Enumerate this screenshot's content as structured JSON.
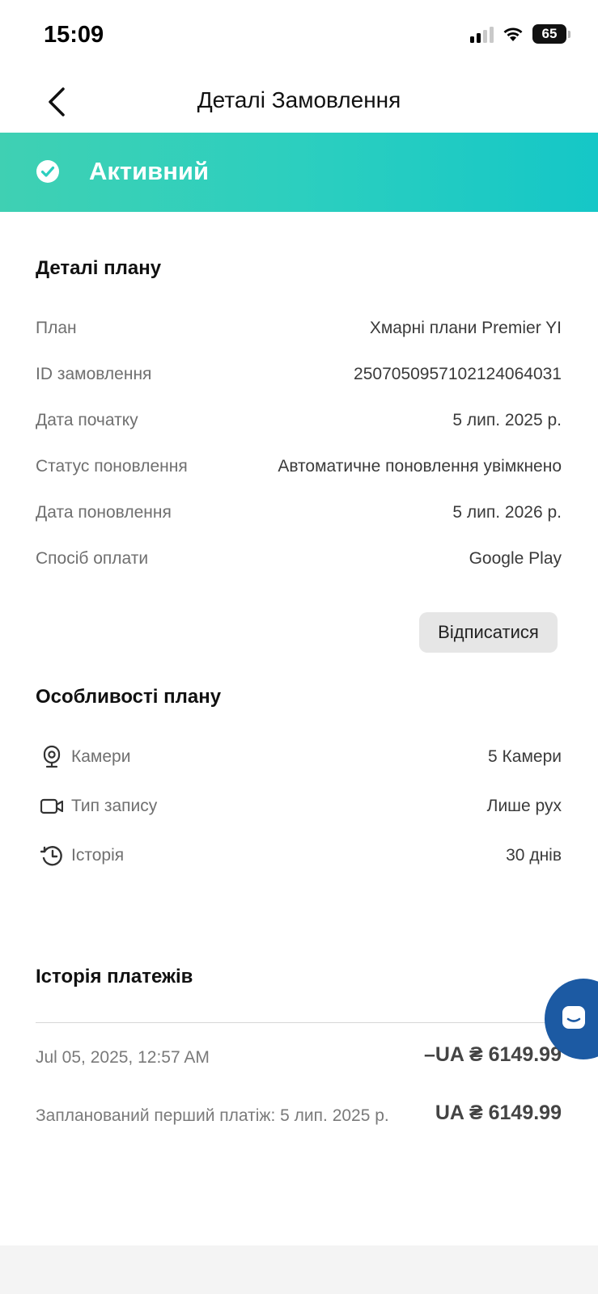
{
  "status_bar": {
    "time": "15:09",
    "battery": "65"
  },
  "nav": {
    "title": "Деталі Замовлення"
  },
  "banner": {
    "status": "Активний",
    "color": "#2ccfbf"
  },
  "plan_details": {
    "title": "Деталі плану",
    "rows": [
      {
        "label": "План",
        "value": "Хмарні плани Premier YI"
      },
      {
        "label": "ID замовлення",
        "value": "2507050957102124064031"
      },
      {
        "label": "Дата початку",
        "value": "5 лип. 2025 р."
      },
      {
        "label": "Статус поновлення",
        "value": "Автоматичне поновлення увімкнено"
      },
      {
        "label": "Дата поновлення",
        "value": "5 лип. 2026 р."
      },
      {
        "label": "Спосіб оплати",
        "value": "Google Play"
      }
    ],
    "unsubscribe_label": "Відписатися"
  },
  "features": {
    "title": "Особливості плану",
    "items": [
      {
        "icon": "camera-icon",
        "label": "Камери",
        "value": "5 Камери"
      },
      {
        "icon": "video-icon",
        "label": "Тип запису",
        "value": "Лише рух"
      },
      {
        "icon": "history-icon",
        "label": "Історія",
        "value": "30 днів"
      }
    ]
  },
  "payments": {
    "title": "Історія платежів",
    "items": [
      {
        "date": "Jul 05, 2025, 12:57 AM",
        "amount": "–UA ₴ 6149.99"
      }
    ],
    "scheduled": {
      "label": "Запланований перший платіж: 5 лип. 2025 р.",
      "amount": "UA ₴ 6149.99"
    }
  },
  "chat": {
    "icon": "chat-icon",
    "color": "#1c5aa3"
  }
}
